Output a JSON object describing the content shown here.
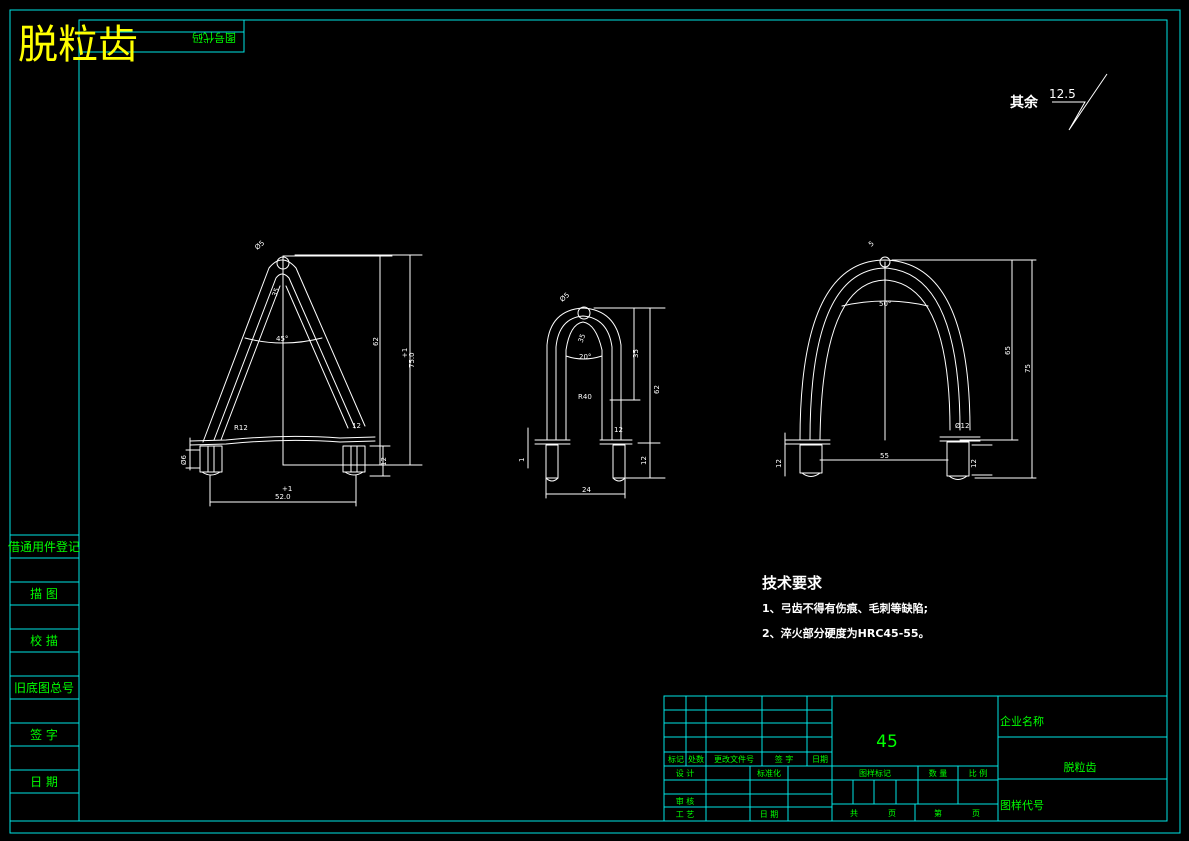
{
  "drawing_title": "脱粒齿",
  "mirrored_stamp": "图号代码",
  "surface_finish": {
    "label": "其余",
    "value": "12.5"
  },
  "tech_requirements": {
    "title": "技术要求",
    "items": [
      "1、弓齿不得有伤痕、毛刺等缺陷;",
      "2、淬火部分硬度为HRC45-55。"
    ]
  },
  "left_sidebar": [
    "借通用件登记",
    "描  图",
    "校  描",
    "旧底图总号",
    "签  字",
    "日  期"
  ],
  "title_block": {
    "material": "45",
    "company": "企业名称",
    "part_name": "脱粒齿",
    "drawing_no_label": "图样代号",
    "revision_headers": [
      "标记",
      "处数",
      "更改文件号",
      "签  字",
      "日期"
    ],
    "design": "设  计",
    "standardization": "标准化",
    "stage_mark": "图样标记",
    "weight": "数  量",
    "scale": "比 例",
    "review": "审  核",
    "process": "工  艺",
    "date": "日  期",
    "total": "共",
    "sheet": "页",
    "page_no": "第",
    "page": "页"
  },
  "views": {
    "view1": {
      "dia5": "Ø5",
      "d35": "35",
      "ang": "45°",
      "r12": "R12",
      "d62": "62",
      "d75": "75.0",
      "tol75": "+1",
      "d52": "52.0",
      "tol52": "+1",
      "d12a": "12",
      "d6": "Ø6",
      "d12b": "12"
    },
    "view2": {
      "dia5": "Ø5",
      "d35a": "35",
      "ang": "20°",
      "r40": "R40",
      "d35b": "35",
      "d62": "62",
      "d12": "12",
      "d24": "24",
      "d12b": "12",
      "d1": "1"
    },
    "view3": {
      "r5": "5",
      "ang": "50°",
      "d65": "65",
      "d75": "75",
      "d55": "55",
      "d12": "12",
      "d6": "Ø12",
      "d12b": "12"
    }
  },
  "colors": {
    "frame": "#00e5e5",
    "lines": "#ffffff",
    "title_text": "#ffff00",
    "block_text": "#00ff00",
    "material": "#00ff00"
  }
}
